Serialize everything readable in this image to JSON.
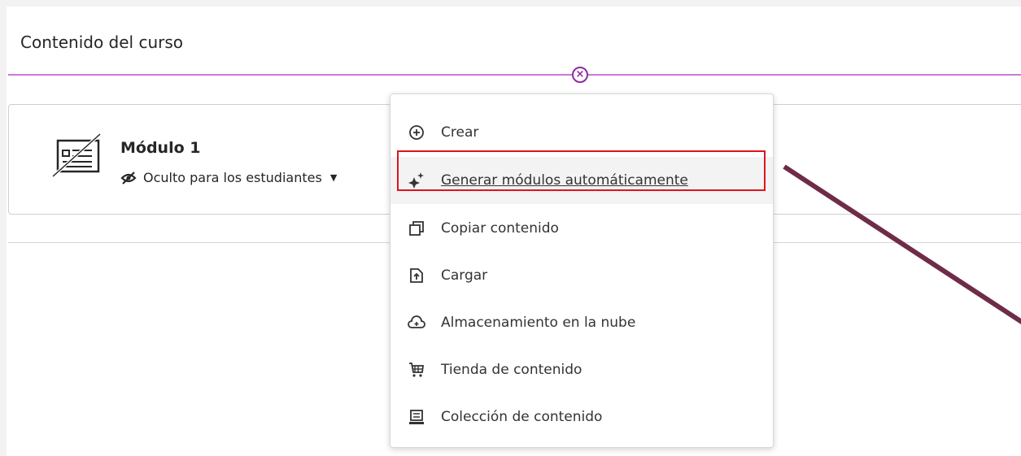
{
  "page": {
    "title": "Contenido del curso"
  },
  "module": {
    "title": "Módulo 1",
    "visibility": "Oculto para los estudiantes"
  },
  "menu": {
    "items": [
      {
        "label": "Crear",
        "icon": "plus-circle-icon"
      },
      {
        "label": "Generar módulos automáticamente",
        "icon": "sparkle-icon",
        "highlighted": true
      },
      {
        "label": "Copiar contenido",
        "icon": "copy-icon"
      },
      {
        "label": "Cargar",
        "icon": "upload-file-icon"
      },
      {
        "label": "Almacenamiento en la nube",
        "icon": "cloud-icon"
      },
      {
        "label": "Tienda de contenido",
        "icon": "cart-icon"
      },
      {
        "label": "Colección de contenido",
        "icon": "collection-icon"
      }
    ]
  },
  "colors": {
    "accent_purple": "#c77bd6",
    "highlight_red": "#e0141e",
    "annotation_arrow": "#6e2c48"
  }
}
